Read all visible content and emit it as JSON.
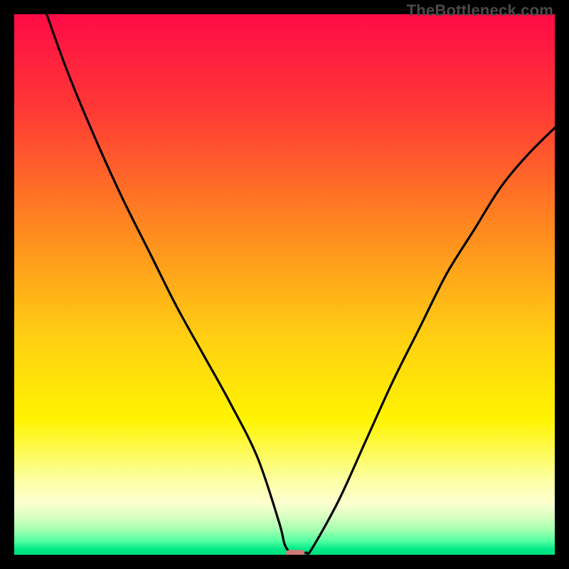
{
  "watermark": "TheBottleneck.com",
  "chart_data": {
    "type": "line",
    "title": "",
    "xlabel": "",
    "ylabel": "",
    "xlim": [
      0,
      100
    ],
    "ylim": [
      0,
      100
    ],
    "grid": false,
    "curve_note": "V-shaped curve dipping to ~0 near x≈52; estimated from pixels (no axis labels present).",
    "series": [
      {
        "name": "curve",
        "color": "#000000",
        "x": [
          6,
          10,
          15,
          20,
          25,
          30,
          35,
          40,
          45,
          49,
          50,
          51,
          52,
          53,
          54,
          55,
          60,
          65,
          70,
          75,
          80,
          85,
          90,
          95,
          100
        ],
        "y": [
          100,
          89,
          77,
          66,
          56,
          46,
          37,
          28,
          18,
          6,
          2,
          0.5,
          0.3,
          0.3,
          0.4,
          1,
          10,
          21,
          32,
          42,
          52,
          60,
          68,
          74,
          79
        ]
      }
    ],
    "marker": {
      "note": "Small salmon rounded marker at curve minimum",
      "x": 52,
      "y": 0.3,
      "color": "#cf7a74"
    },
    "background_gradient": {
      "type": "vertical",
      "stops": [
        {
          "pos": 0.0,
          "color": "#ff0b46"
        },
        {
          "pos": 0.18,
          "color": "#ff3a35"
        },
        {
          "pos": 0.4,
          "color": "#ff8a1f"
        },
        {
          "pos": 0.6,
          "color": "#ffd012"
        },
        {
          "pos": 0.75,
          "color": "#fff400"
        },
        {
          "pos": 0.86,
          "color": "#fcffa0"
        },
        {
          "pos": 0.905,
          "color": "#fbffd0"
        },
        {
          "pos": 0.93,
          "color": "#d8ffc0"
        },
        {
          "pos": 0.955,
          "color": "#a0ffb0"
        },
        {
          "pos": 0.975,
          "color": "#4fffa0"
        },
        {
          "pos": 0.99,
          "color": "#00e887"
        },
        {
          "pos": 1.0,
          "color": "#00e07e"
        }
      ]
    }
  }
}
